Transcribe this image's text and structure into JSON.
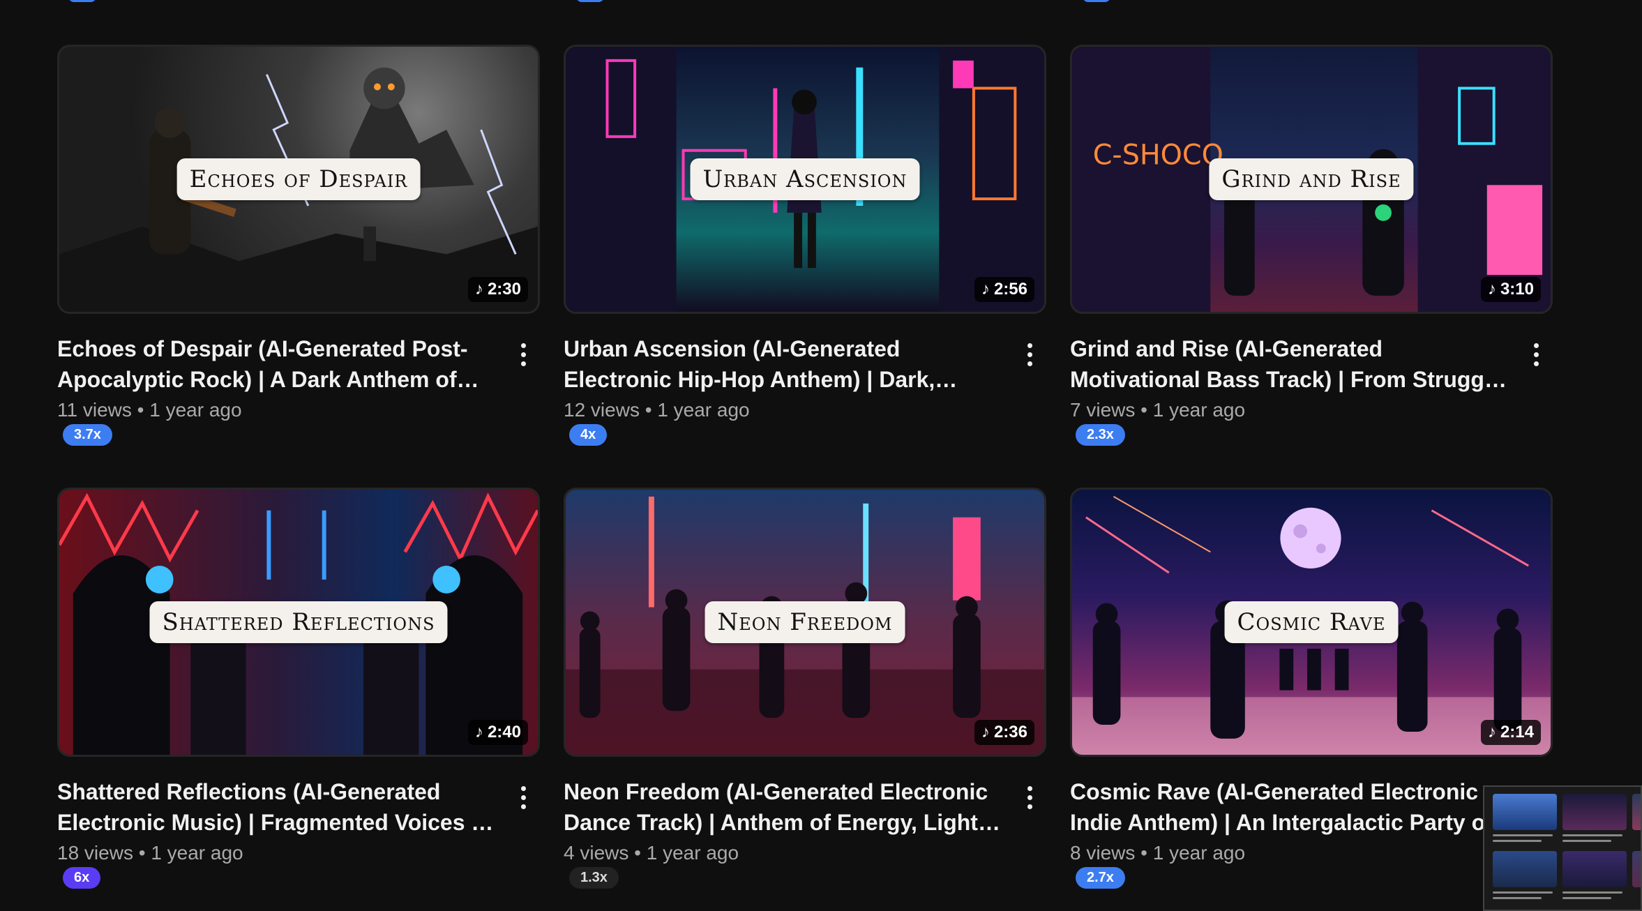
{
  "videos": [
    {
      "title": "Echoes of Despair (AI-Generated Post-Apocalyptic Rock) | A Dark Anthem of Inner Struggle",
      "overlay": "Echoes of Despair",
      "duration": "2:30",
      "views": "11 views",
      "age": "1 year ago",
      "badge": "3.7x"
    },
    {
      "title": "Urban Ascension (AI-Generated Electronic Hip-Hop Anthem) | Dark, Majestic Beats for Rising Up",
      "overlay": "Urban Ascension",
      "duration": "2:56",
      "views": "12 views",
      "age": "1 year ago",
      "badge": "4x"
    },
    {
      "title": "Grind and Rise (AI-Generated Motivational Bass Track) | From Struggle to Self-Worth & Victory",
      "overlay": "Grind and Rise",
      "duration": "3:10",
      "views": "7 views",
      "age": "1 year ago",
      "badge": "2.3x"
    },
    {
      "title": "Shattered Reflections (AI-Generated Electronic Music) | Fragmented Voices & Distorted Beats",
      "overlay": "Shattered Reflections",
      "duration": "2:40",
      "views": "18 views",
      "age": "1 year ago",
      "badge": "6x"
    },
    {
      "title": "Neon Freedom (AI-Generated Electronic Dance Track) | Anthem of Energy, Lights & Movement",
      "overlay": "Neon Freedom",
      "duration": "2:36",
      "views": "4 views",
      "age": "1 year ago",
      "badge": "1.3x"
    },
    {
      "title": "Cosmic Rave (AI-Generated Electronic Indie Anthem) | An Intergalactic Party of Sound",
      "overlay": "Cosmic Rave",
      "duration": "2:14",
      "views": "8 views",
      "age": "1 year ago",
      "badge": "2.7x"
    }
  ],
  "separator": "•",
  "icons": {
    "duration": "music-note-icon",
    "menu": "more-vert-icon"
  },
  "colors": {
    "background": "#0f0f0f",
    "badge_blue": "#3d7df2",
    "badge_purple": "#5b3cf5",
    "badge_gray": "#222222"
  }
}
